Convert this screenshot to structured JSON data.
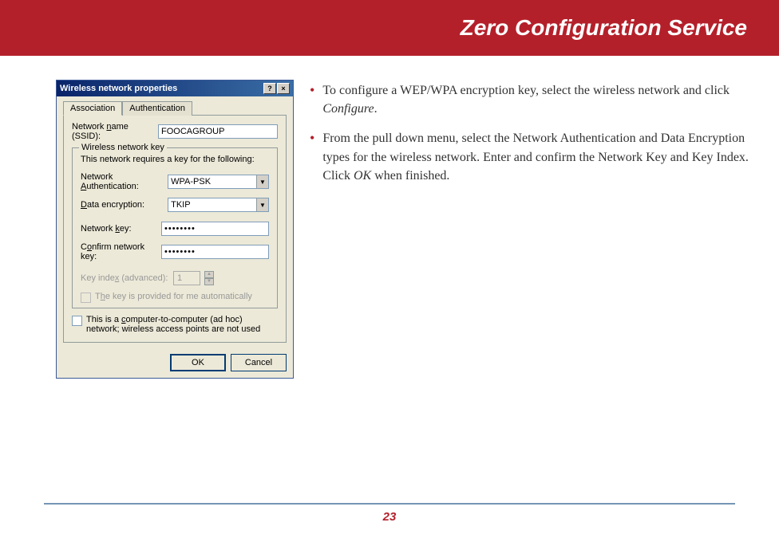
{
  "header": {
    "title": "Zero Configuration Service"
  },
  "dialog": {
    "title": "Wireless network properties",
    "help_btn": "?",
    "close_btn": "×",
    "tabs": {
      "association": "Association",
      "authentication": "Authentication"
    },
    "ssid_label": "Network name (SSID):",
    "ssid_value": "FOOCAGROUP",
    "group_title": "Wireless network key",
    "group_text": "This network requires a key for the following:",
    "auth_label": "Network Authentication:",
    "auth_value": "WPA-PSK",
    "enc_label": "Data encryption:",
    "enc_value": "TKIP",
    "key_label": "Network key:",
    "key_value": "••••••••",
    "confirm_label": "Confirm network key:",
    "confirm_value": "••••••••",
    "keyidx_label": "Key index (advanced):",
    "keyidx_value": "1",
    "auto_key_label": "The key is provided for me automatically",
    "adhoc_label": "This is a computer-to-computer (ad hoc) network; wireless access points are not used",
    "ok": "OK",
    "cancel": "Cancel"
  },
  "instructions": {
    "item1_a": "To configure a WEP/WPA encryption key, select the wireless network and click ",
    "item1_b": "Configure",
    "item1_c": ".",
    "item2_a": "From the pull down menu, select the Network Authentication and Data Encryption types for the wireless network.  Enter and confirm the Network Key and Key Index.  Click ",
    "item2_b": "OK",
    "item2_c": " when finished."
  },
  "page_number": "23"
}
